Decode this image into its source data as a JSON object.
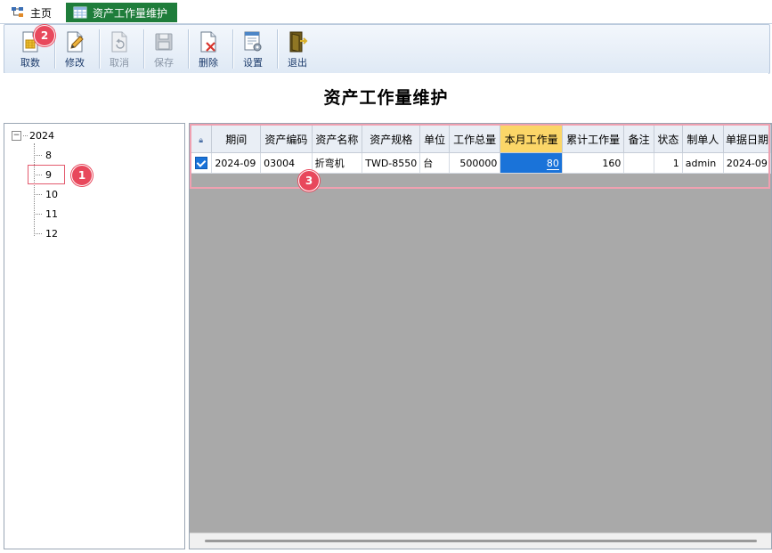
{
  "tabs": [
    {
      "label": "主页",
      "icon": "home-tree-icon",
      "active": false
    },
    {
      "label": "资产工作量维护",
      "icon": "table-icon",
      "active": true
    }
  ],
  "toolbar": {
    "buttons": [
      {
        "label": "取数",
        "icon": "fetch-data-icon",
        "enabled": true
      },
      {
        "label": "修改",
        "icon": "edit-icon",
        "enabled": true
      },
      {
        "label": "取消",
        "icon": "undo-icon",
        "enabled": false
      },
      {
        "label": "保存",
        "icon": "save-icon",
        "enabled": false
      },
      {
        "label": "删除",
        "icon": "delete-icon",
        "enabled": true
      },
      {
        "label": "设置",
        "icon": "settings-icon",
        "enabled": true
      },
      {
        "label": "退出",
        "icon": "exit-icon",
        "enabled": true
      }
    ]
  },
  "page_title": "资产工作量维护",
  "tree": {
    "root": "2024",
    "children": [
      "8",
      "9",
      "10",
      "11",
      "12"
    ],
    "selected": "9"
  },
  "grid": {
    "columns": [
      "期间",
      "资产编码",
      "资产名称",
      "资产规格",
      "单位",
      "工作总量",
      "本月工作量",
      "累计工作量",
      "备注",
      "状态",
      "制单人",
      "单据日期"
    ],
    "highlight_column": "本月工作量",
    "rows": [
      {
        "checked": true,
        "cells": [
          "2024-09",
          "03004",
          "折弯机",
          "TWD-8550",
          "台",
          "500000",
          "80",
          "160",
          "",
          "1",
          "admin",
          "2024-09"
        ]
      }
    ]
  },
  "callouts": [
    "1",
    "2",
    "3"
  ],
  "colors": {
    "active_tab": "#1f7d3b",
    "highlight_header": "#fbd668",
    "selected_cell": "#1a73d9",
    "callout": "#e8485c",
    "grid_empty_area": "#a9a9a9"
  }
}
